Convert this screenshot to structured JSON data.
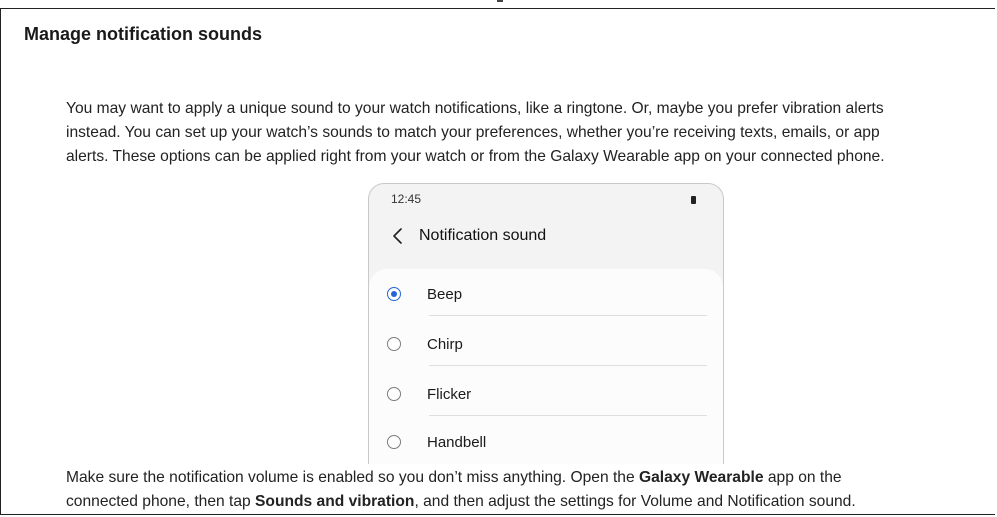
{
  "article": {
    "title": "Manage notification sounds",
    "intro_lines": [
      "You may want to apply a unique sound to your watch notifications, like a ringtone. Or, maybe you prefer vibration alerts",
      "instead. You can set up your watch’s sounds to match your preferences, whether you’re receiving texts, emails, or app",
      "alerts. These options can be applied right from your watch or from the Galaxy Wearable app on your connected phone."
    ],
    "footer": {
      "line1_part1": "Make sure the notification volume is enabled so you don’t miss anything. Open the ",
      "line1_bold": "Galaxy Wearable",
      "line1_part2": " app on the",
      "line2_part1": "connected phone, then tap ",
      "line2_bold": "Sounds and vibration",
      "line2_part2": ", and then adjust the settings for Volume and Notification sound."
    }
  },
  "phone": {
    "status_time": "12:45",
    "screen_title": "Notification sound",
    "back_icon": "chevron-left-icon",
    "accent_color": "#2565d8",
    "options": [
      {
        "label": "Beep",
        "selected": true
      },
      {
        "label": "Chirp",
        "selected": false
      },
      {
        "label": "Flicker",
        "selected": false
      },
      {
        "label": "Handbell",
        "selected": false
      }
    ]
  }
}
